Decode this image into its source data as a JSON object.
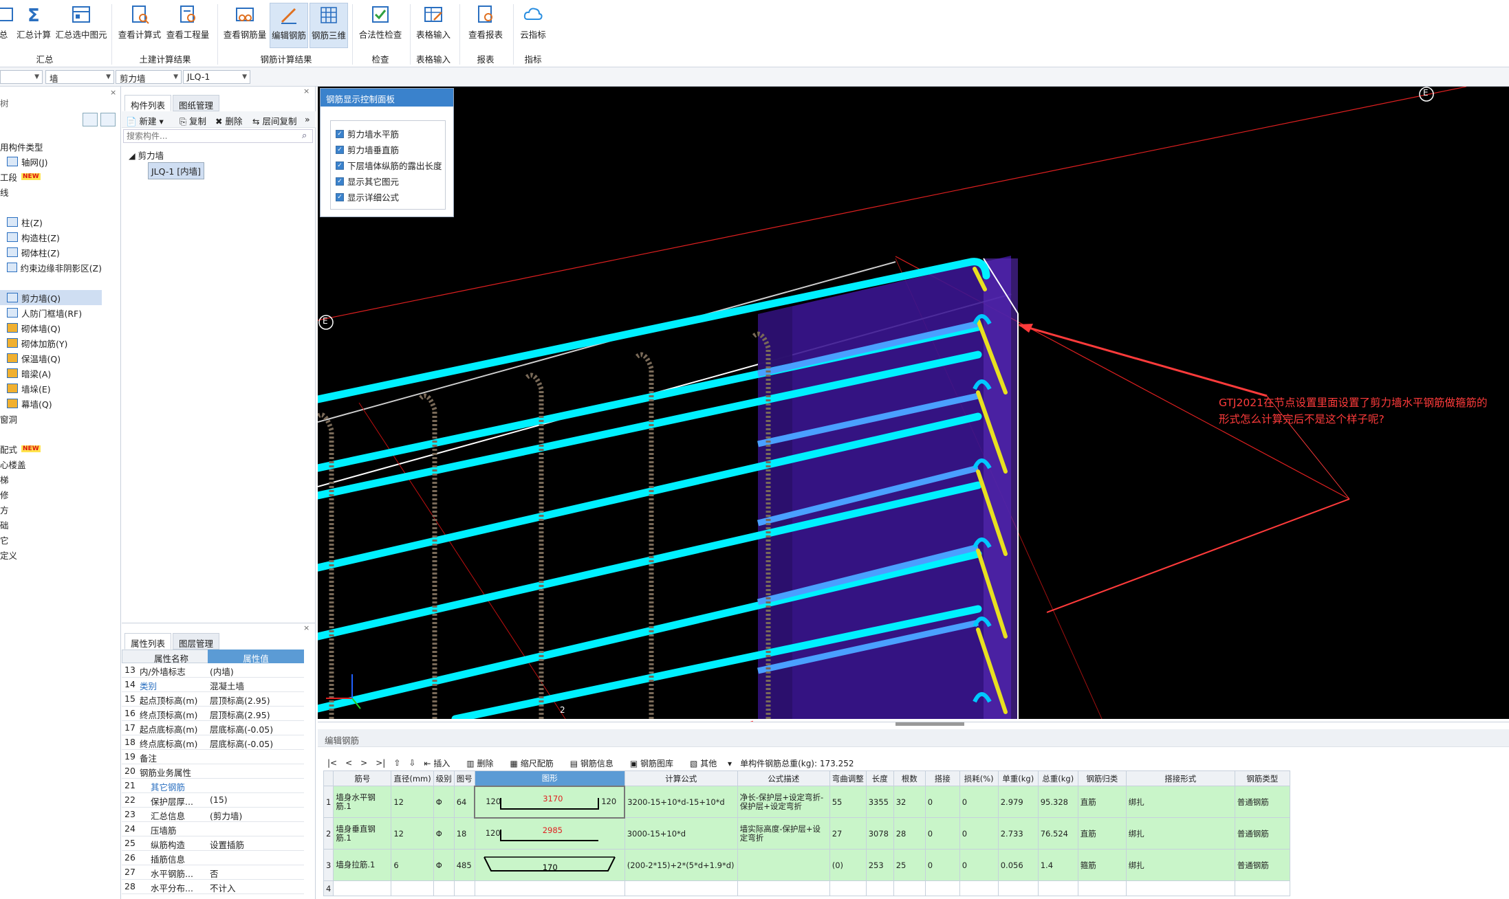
{
  "ribbon": {
    "buttons": [
      {
        "label": "总",
        "icon": "summary-icon"
      },
      {
        "label": "汇总计算",
        "icon": "sigma-icon"
      },
      {
        "label": "汇总选中图元",
        "icon": "summary-selected-icon"
      },
      {
        "label": "查看计算式",
        "icon": "formula-view-icon"
      },
      {
        "label": "查看工程量",
        "icon": "quantity-view-icon"
      },
      {
        "label": "查看钢筋量",
        "icon": "rebar-quantity-icon"
      },
      {
        "label": "编辑钢筋",
        "icon": "edit-rebar-icon"
      },
      {
        "label": "钢筋三维",
        "icon": "rebar-3d-icon"
      },
      {
        "label": "合法性检查",
        "icon": "check-icon"
      },
      {
        "label": "表格输入",
        "icon": "table-input-icon"
      },
      {
        "label": "查看报表",
        "icon": "report-icon"
      },
      {
        "label": "云指标",
        "icon": "cloud-icon"
      }
    ],
    "groups": [
      "汇总",
      "土建计算结果",
      "钢筋计算结果",
      "检查",
      "表格输入",
      "报表",
      "指标"
    ]
  },
  "selectors": [
    "",
    "墙",
    "剪力墙",
    "JLQ-1"
  ],
  "nav": {
    "header": "树",
    "items": [
      "用构件类型",
      "轴网(J)",
      "工段",
      "线",
      "柱(Z)",
      "构造柱(Z)",
      "砌体柱(Z)",
      "约束边缘非阴影区(Z)",
      "剪力墙(Q)",
      "人防门框墙(RF)",
      "砌体墙(Q)",
      "砌体加筋(Y)",
      "保温墙(Q)",
      "暗梁(A)",
      "墙垛(E)",
      "幕墙(Q)",
      "窗洞",
      "配式",
      "心楼盖",
      "梯",
      "修",
      "方",
      "础",
      "它",
      "定义"
    ],
    "new_badge": "NEW"
  },
  "components": {
    "tabs": [
      "构件列表",
      "图纸管理"
    ],
    "toolbar": [
      "新建",
      "复制",
      "删除",
      "层间复制"
    ],
    "search_placeholder": "搜索构件...",
    "tree_root": "剪力墙",
    "tree_child": "JLQ-1 [内墙]"
  },
  "properties": {
    "tabs": [
      "属性列表",
      "图层管理"
    ],
    "col_name": "属性名称",
    "col_value": "属性值",
    "rows": [
      {
        "no": "13",
        "name": "内/外墙标志",
        "value": "(内墙)"
      },
      {
        "no": "14",
        "name": "类别",
        "value": "混凝土墙"
      },
      {
        "no": "15",
        "name": "起点顶标高(m)",
        "value": "层顶标高(2.95)"
      },
      {
        "no": "16",
        "name": "终点顶标高(m)",
        "value": "层顶标高(2.95)"
      },
      {
        "no": "17",
        "name": "起点底标高(m)",
        "value": "层底标高(-0.05)"
      },
      {
        "no": "18",
        "name": "终点底标高(m)",
        "value": "层底标高(-0.05)"
      },
      {
        "no": "19",
        "name": "备注",
        "value": ""
      },
      {
        "no": "20",
        "name": "钢筋业务属性",
        "value": ""
      },
      {
        "no": "21",
        "name": "其它钢筋",
        "value": ""
      },
      {
        "no": "22",
        "name": "保护层厚...",
        "value": "(15)"
      },
      {
        "no": "23",
        "name": "汇总信息",
        "value": "(剪力墙)"
      },
      {
        "no": "24",
        "name": "压墙筋",
        "value": ""
      },
      {
        "no": "25",
        "name": "纵筋构造",
        "value": "设置插筋"
      },
      {
        "no": "26",
        "name": "插筋信息",
        "value": ""
      },
      {
        "no": "27",
        "name": "水平钢筋...",
        "value": "否"
      },
      {
        "no": "28",
        "name": "水平分布...",
        "value": "不计入"
      }
    ]
  },
  "control_panel": {
    "title": "钢筋显示控制面板",
    "options": [
      "剪力墙水平筋",
      "剪力墙垂直筋",
      "下层墙体纵筋的露出长度",
      "显示其它图元",
      "显示详细公式"
    ]
  },
  "viewport": {
    "axis_label": "E",
    "axis_label2": "2",
    "annotation_line1": "GTJ2021在节点设置里面设置了剪力墙水平钢筋做箍筋的",
    "annotation_line2": "形式怎么计算完后不是这个样子呢?"
  },
  "edit_rebar": {
    "title": "编辑钢筋",
    "toolbar": [
      "插入",
      "删除",
      "缩尺配筋",
      "钢筋信息",
      "钢筋图库",
      "其他"
    ],
    "total_weight": "单构件钢筋总重(kg): 173.252",
    "columns": [
      "筋号",
      "直径(mm)",
      "级别",
      "图号",
      "图形",
      "计算公式",
      "公式描述",
      "弯曲调整",
      "长度",
      "根数",
      "搭接",
      "损耗(%)",
      "单重(kg)",
      "总重(kg)",
      "钢筋归类",
      "搭接形式",
      "钢筋类型"
    ],
    "rows": [
      {
        "no": "1",
        "name": "墙身水平钢筋.1",
        "dia": "12",
        "grade": "Φ",
        "fig": "64",
        "shape_left": "120",
        "shape_mid": "3170",
        "shape_right": "120",
        "formula": "3200-15+10*d-15+10*d",
        "desc": "净长-保护层+设定弯折-保护层+设定弯折",
        "bend": "55",
        "len": "3355",
        "count": "32",
        "lap": "0",
        "loss": "0",
        "unit": "2.979",
        "total": "95.328",
        "cls": "直筋",
        "lapform": "绑扎",
        "type": "普通钢筋"
      },
      {
        "no": "2",
        "name": "墙身垂直钢筋.1",
        "dia": "12",
        "grade": "Φ",
        "fig": "18",
        "shape_left": "120",
        "shape_mid": "2985",
        "shape_right": "",
        "formula": "3000-15+10*d",
        "desc": "墙实际高度-保护层+设定弯折",
        "bend": "27",
        "len": "3078",
        "count": "28",
        "lap": "0",
        "loss": "0",
        "unit": "2.733",
        "total": "76.524",
        "cls": "直筋",
        "lapform": "绑扎",
        "type": "普通钢筋"
      },
      {
        "no": "3",
        "name": "墙身拉筋.1",
        "dia": "6",
        "grade": "Φ",
        "fig": "485",
        "shape_left": "",
        "shape_mid": "170",
        "shape_right": "",
        "formula": "(200-2*15)+2*(5*d+1.9*d)",
        "desc": "",
        "bend": "(0)",
        "len": "253",
        "count": "25",
        "lap": "0",
        "loss": "0",
        "unit": "0.056",
        "total": "1.4",
        "cls": "箍筋",
        "lapform": "绑扎",
        "type": "普通钢筋"
      },
      {
        "no": "4",
        "name": "",
        "dia": "",
        "grade": "",
        "fig": "",
        "shape_left": "",
        "shape_mid": "",
        "shape_right": "",
        "formula": "",
        "desc": "",
        "bend": "",
        "len": "",
        "count": "",
        "lap": "",
        "loss": "",
        "unit": "",
        "total": "",
        "cls": "",
        "lapform": "",
        "type": ""
      }
    ]
  },
  "colors": {
    "accent": "#3a82cc",
    "rebar_cyan": "#00f0ff",
    "wall_purple": "#4a1fa0",
    "annotation_red": "#ff3b3b",
    "row_green": "#c9f5c9"
  }
}
